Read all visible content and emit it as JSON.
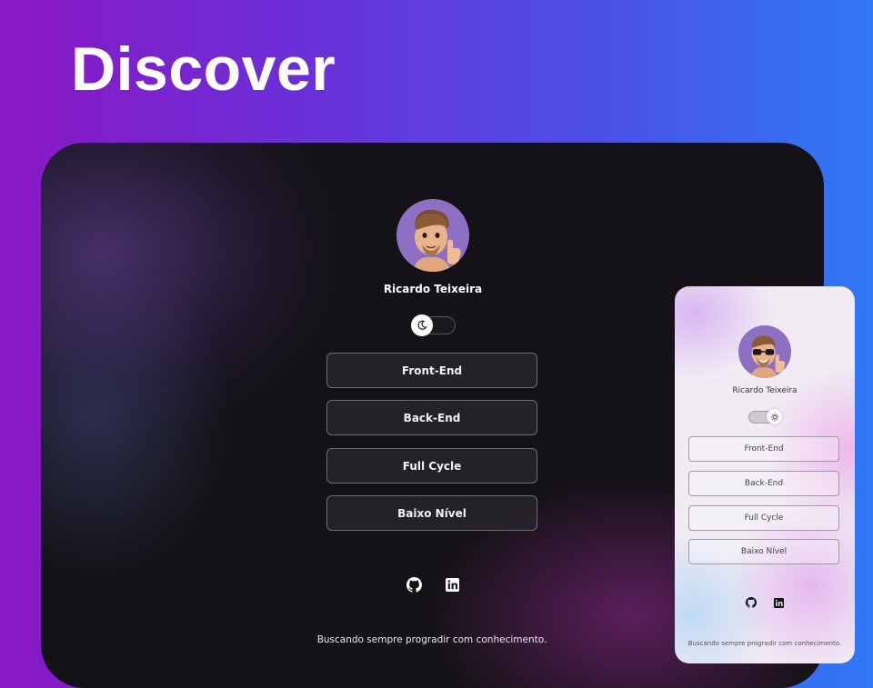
{
  "headline": "Discover",
  "profile": {
    "name": "Ricardo Teixeira",
    "footer": "Buscando sempre progradir com conhecimento."
  },
  "links": [
    {
      "label": "Front-End"
    },
    {
      "label": "Back-End"
    },
    {
      "label": "Full Cycle"
    },
    {
      "label": "Baixo Nível"
    }
  ],
  "theme_toggle": {
    "dark_icon": "moon-icon",
    "light_icon": "sun-icon"
  },
  "social": [
    {
      "icon": "github-icon"
    },
    {
      "icon": "linkedin-icon"
    }
  ],
  "colors": {
    "background_left": "#8a17c4",
    "background_right": "#2f78f6",
    "dark_card": "#141216",
    "light_card": "#f1ebf4",
    "avatar_bg": "#8d6fc4"
  }
}
